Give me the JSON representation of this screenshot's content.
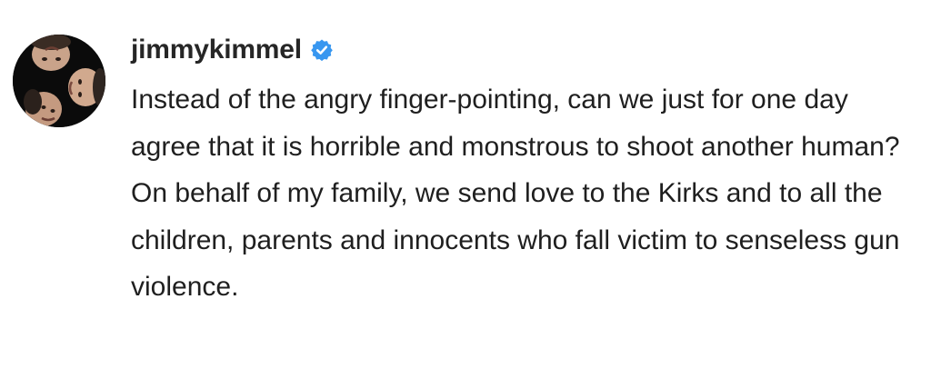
{
  "post": {
    "username": "jimmykimmel",
    "verified": true,
    "avatar_icon": "profile-photo-icon",
    "verified_icon": "verified-badge-icon",
    "caption": "Instead of the angry finger-pointing, can we just for one day agree that it is horrible and monstrous to shoot another human? On behalf of my family, we send love to the Kirks and to all the children, parents and innocents who fall victim to senseless gun violence."
  },
  "colors": {
    "text": "#262626",
    "verified_blue": "#3897f0",
    "background": "#ffffff"
  }
}
